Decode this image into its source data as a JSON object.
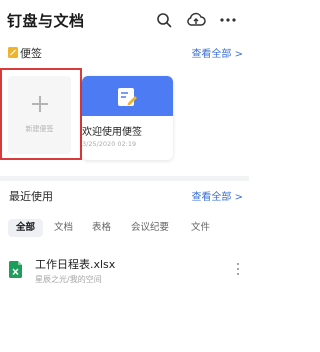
{
  "header": {
    "title": "钉盘与文档",
    "search_icon": "search-icon",
    "upload_icon": "cloud-upload-icon",
    "more_icon": "more-horizontal-icon"
  },
  "notes_section": {
    "title": "便签",
    "icon": "note-icon",
    "see_all": "查看全部 >",
    "new_card": {
      "label": "新建便签"
    },
    "cards": [
      {
        "title": "欢迎使用便签",
        "date": "3/25/2020 02:19",
        "banner_color": "#4d7bf3"
      }
    ]
  },
  "recent_section": {
    "title": "最近使用",
    "see_all": "查看全部 >",
    "tabs": [
      {
        "label": "全部",
        "active": true
      },
      {
        "label": "文档",
        "active": false
      },
      {
        "label": "表格",
        "active": false
      },
      {
        "label": "会议纪要",
        "active": false
      },
      {
        "label": "文件",
        "active": false
      }
    ],
    "files": [
      {
        "name": "工作日程表.xlsx",
        "path": "星辰之光/我的空间",
        "icon": "excel-file-icon"
      }
    ]
  },
  "colors": {
    "accent": "#3a6fd8",
    "highlight_border": "#d93a3a",
    "excel_green": "#1e9e5a"
  }
}
